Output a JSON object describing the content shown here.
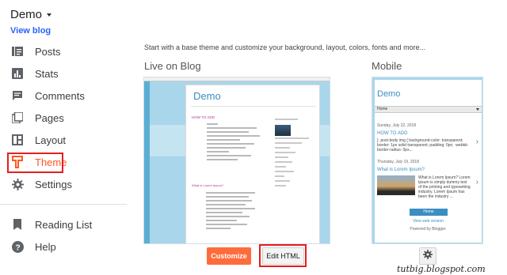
{
  "sidebar": {
    "blog_title": "Demo",
    "view_blog": "View blog",
    "items": [
      {
        "label": "Posts",
        "icon": "posts-icon"
      },
      {
        "label": "Stats",
        "icon": "stats-icon"
      },
      {
        "label": "Comments",
        "icon": "comments-icon"
      },
      {
        "label": "Pages",
        "icon": "pages-icon"
      },
      {
        "label": "Layout",
        "icon": "layout-icon"
      },
      {
        "label": "Theme",
        "icon": "theme-icon",
        "active": true
      },
      {
        "label": "Settings",
        "icon": "settings-icon"
      }
    ],
    "footer_items": [
      {
        "label": "Reading List",
        "icon": "bookmark-icon"
      },
      {
        "label": "Help",
        "icon": "help-icon"
      }
    ]
  },
  "main": {
    "intro": "Start with a base theme and customize your background, layout, colors, fonts and more...",
    "live_title": "Live on Blog",
    "mobile_title": "Mobile",
    "customize_label": "Customize",
    "edit_html_label": "Edit HTML"
  },
  "live_preview": {
    "blog_name": "Demo",
    "post_title": "HOW TO ADD",
    "post2_title": "What is Lorem Ipsum?"
  },
  "mobile_preview": {
    "blog_name": "Demo",
    "home_label": "Home",
    "post1_date": "Sunday, July 22, 2018",
    "post1_title": "HOW TO ADD",
    "post1_text": "} .post-body img {     background-color: transparent; border: 1px solid transparent;    padding: 0px;    -webkit-border-radius: 0px...",
    "post2_date": "Thursday, July 19, 2018",
    "post2_title": "What is Lorem Ipsum?",
    "post2_text": "What is Lorem Ipsum? Lorem Ipsum  is simply dummy text of the printing and typesetting industry. Lorem Ipsum has been the industry ...",
    "home_button": "Home",
    "web_version": "View web version",
    "powered_by": "Powered by Blogger."
  },
  "watermark": "tutbig.blogspot.com",
  "colors": {
    "accent": "#ff5722",
    "link": "#2962ff",
    "highlight_box": "#e41e1e",
    "customize_button": "#ff6c3b"
  }
}
